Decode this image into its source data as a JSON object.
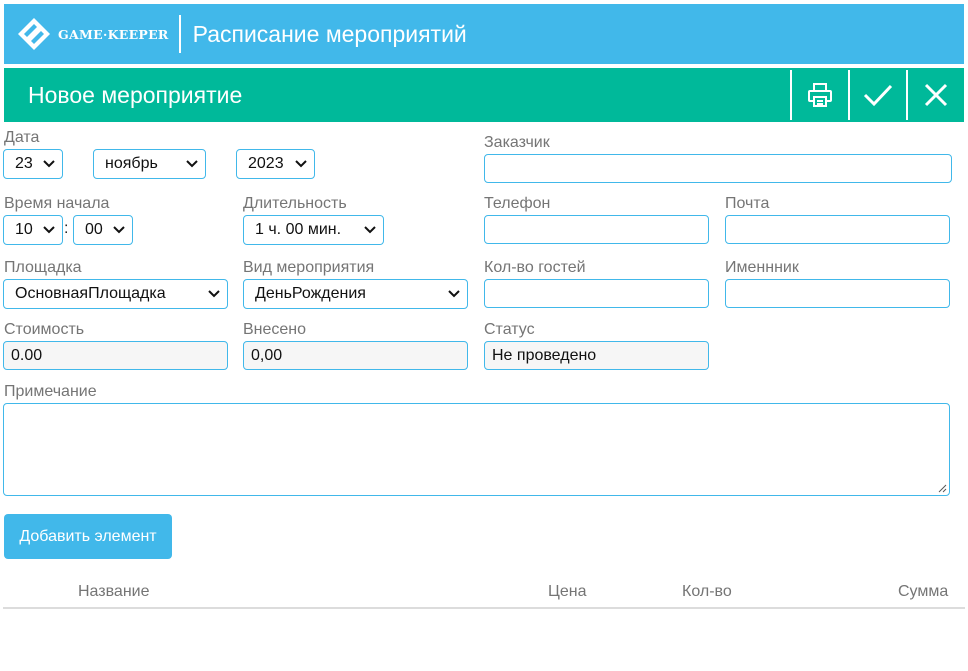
{
  "header": {
    "logo_text": "GAME·KEEPER",
    "title": "Расписание мероприятий"
  },
  "form": {
    "title": "Новое мероприятие",
    "date": {
      "label": "Дата",
      "day": "23",
      "month": "ноябрь",
      "year": "2023"
    },
    "start_time": {
      "label": "Время начала",
      "hour": "10",
      "separator": ":",
      "minute": "00"
    },
    "duration": {
      "label": "Длительность",
      "value": "1 ч. 00 мин."
    },
    "venue": {
      "label": "Площадка",
      "value": "ОсновнаяПлощадка"
    },
    "event_type": {
      "label": "Вид мероприятия",
      "value": "ДеньРождения"
    },
    "cost": {
      "label": "Стоимость",
      "value": "0.00"
    },
    "paid": {
      "label": "Внесено",
      "value": "0,00"
    },
    "customer": {
      "label": "Заказчик",
      "value": ""
    },
    "phone": {
      "label": "Телефон",
      "value": ""
    },
    "email": {
      "label": "Почта",
      "value": ""
    },
    "guests": {
      "label": "Кол-во гостей",
      "value": ""
    },
    "birthday_person": {
      "label": "Именнник",
      "value": ""
    },
    "status": {
      "label": "Статус",
      "value": "Не проведено"
    },
    "note": {
      "label": "Примечание",
      "value": ""
    },
    "add_button": "Добавить элемент"
  },
  "table": {
    "columns": [
      "Название",
      "Цена",
      "Кол-во",
      "Сумма"
    ]
  },
  "icons": {
    "toolbar": [
      "printer-icon",
      "check-icon",
      "close-icon"
    ]
  },
  "colors": {
    "header_bg": "#41b8ea",
    "subheader_bg": "#00b99a",
    "border": "#41b8ea"
  }
}
